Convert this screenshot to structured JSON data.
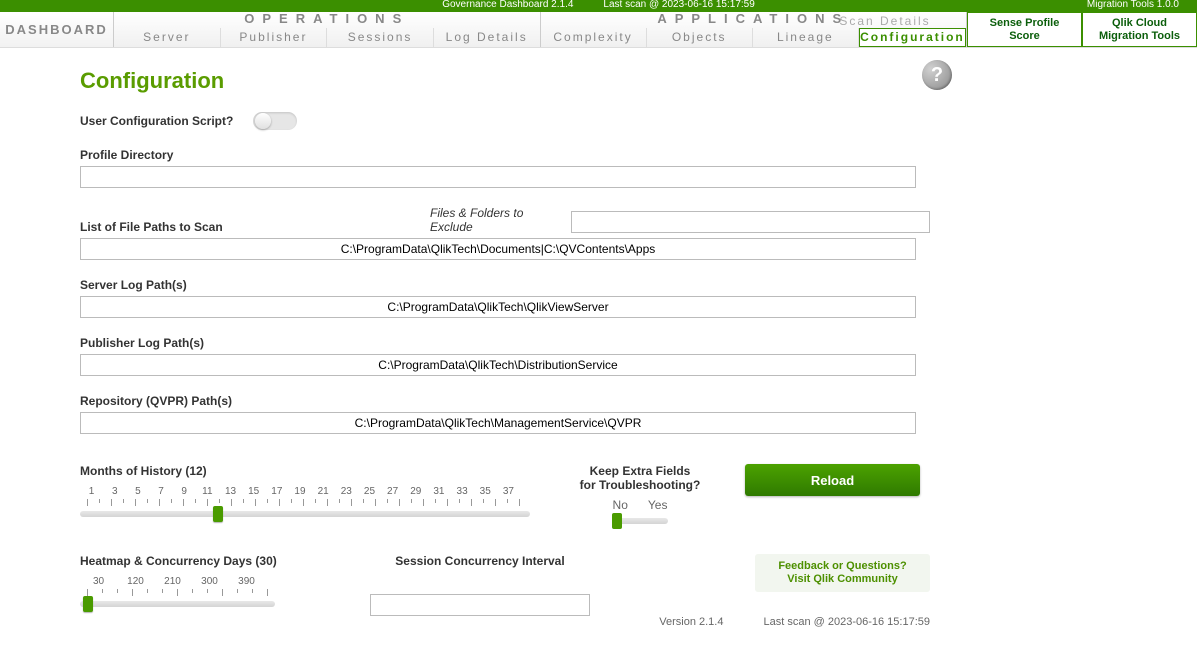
{
  "topbar": {
    "gov_dashboard": "Governance Dashboard 2.1.4",
    "last_scan": "Last scan @ 2023-06-16 15:17:59",
    "migration_tools": "Migration Tools 1.0.0"
  },
  "nav": {
    "dashboard": "DASHBOARD",
    "operations": "OPERATIONS",
    "applications": "APPLICATIONS",
    "ops_tabs": [
      "Server",
      "Publisher",
      "Sessions",
      "Log Details"
    ],
    "app_tabs": [
      "Complexity",
      "Objects",
      "Lineage",
      "Configuration"
    ],
    "scan_details": "Scan Details",
    "rightbtn1_l1": "Sense Profile",
    "rightbtn1_l2": "Score",
    "rightbtn2_l1": "Qlik Cloud",
    "rightbtn2_l2": "Migration Tools"
  },
  "page": {
    "title": "Configuration",
    "user_config_label": "User Configuration Script?",
    "profile_dir_label": "Profile Directory",
    "profile_dir_value": "",
    "filepaths_label": "List of File Paths to Scan",
    "exclude_label": "Files & Folders to Exclude",
    "exclude_value": "",
    "filepaths_value": "C:\\ProgramData\\QlikTech\\Documents|C:\\QVContents\\Apps",
    "server_log_label": "Server Log Path(s)",
    "server_log_value": "C:\\ProgramData\\QlikTech\\QlikViewServer",
    "publisher_log_label": "Publisher Log Path(s)",
    "publisher_log_value": "C:\\ProgramData\\QlikTech\\DistributionService",
    "repo_label": "Repository (QVPR) Path(s)",
    "repo_value": "C:\\ProgramData\\QlikTech\\ManagementService\\QVPR",
    "months_label": "Months of History (12)",
    "months_ticks": [
      "1",
      "3",
      "5",
      "7",
      "9",
      "11",
      "13",
      "15",
      "17",
      "19",
      "21",
      "23",
      "25",
      "27",
      "29",
      "31",
      "33",
      "35",
      "37"
    ],
    "heatmap_label": "Heatmap & Concurrency Days (30)",
    "heatmap_ticks": [
      "30",
      "120",
      "210",
      "300",
      "390"
    ],
    "session_label": "Session Concurrency Interval",
    "session_value": "",
    "keep_label_l1": "Keep Extra Fields",
    "keep_label_l2": "for Troubleshooting?",
    "no": "No",
    "yes": "Yes",
    "reload": "Reload",
    "feedback_l1": "Feedback or Questions?",
    "feedback_l2": "Visit Qlik Community",
    "version": "Version 2.1.4",
    "last_scan_footer": "Last scan @ 2023-06-16 15:17:59"
  }
}
